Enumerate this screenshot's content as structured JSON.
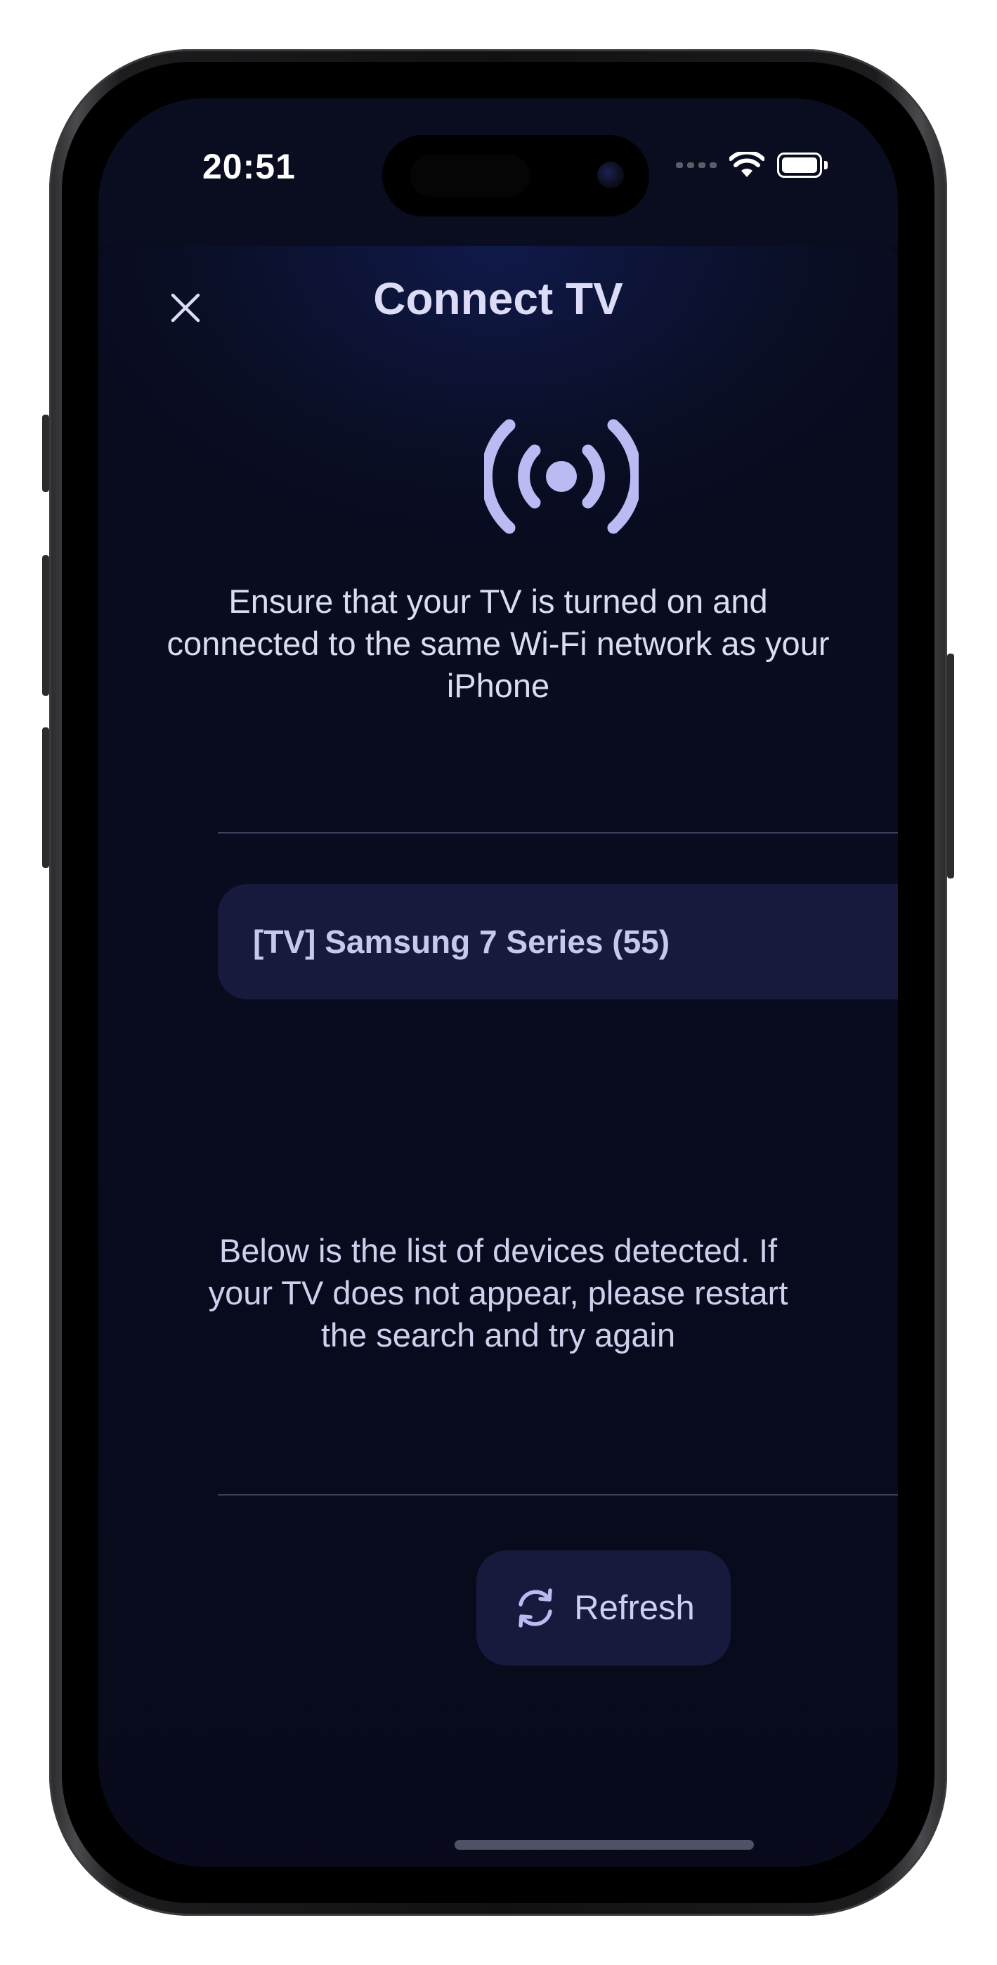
{
  "status_bar": {
    "time": "20:51",
    "icons": [
      "cellular-signal-icon",
      "wifi-icon",
      "battery-icon"
    ]
  },
  "header": {
    "title": "Connect TV",
    "close_icon": "close-icon"
  },
  "hero": {
    "icon": "broadcast-icon",
    "description": "Ensure that your TV is turned on and connected to the same Wi-Fi network as your iPhone"
  },
  "devices": [
    {
      "label": "[TV] Samsung 7 Series (55)",
      "icon": "chevron-right-icon"
    }
  ],
  "footer": {
    "note": "Below is the list of devices detected. If your TV does not appear, please restart the search and try again",
    "refresh_label": "Refresh",
    "refresh_icon": "refresh-icon"
  },
  "colors": {
    "background": "#090c1f",
    "card": "#171a3d",
    "accent": "#b9bbf2",
    "text": "#dcdcf6"
  }
}
